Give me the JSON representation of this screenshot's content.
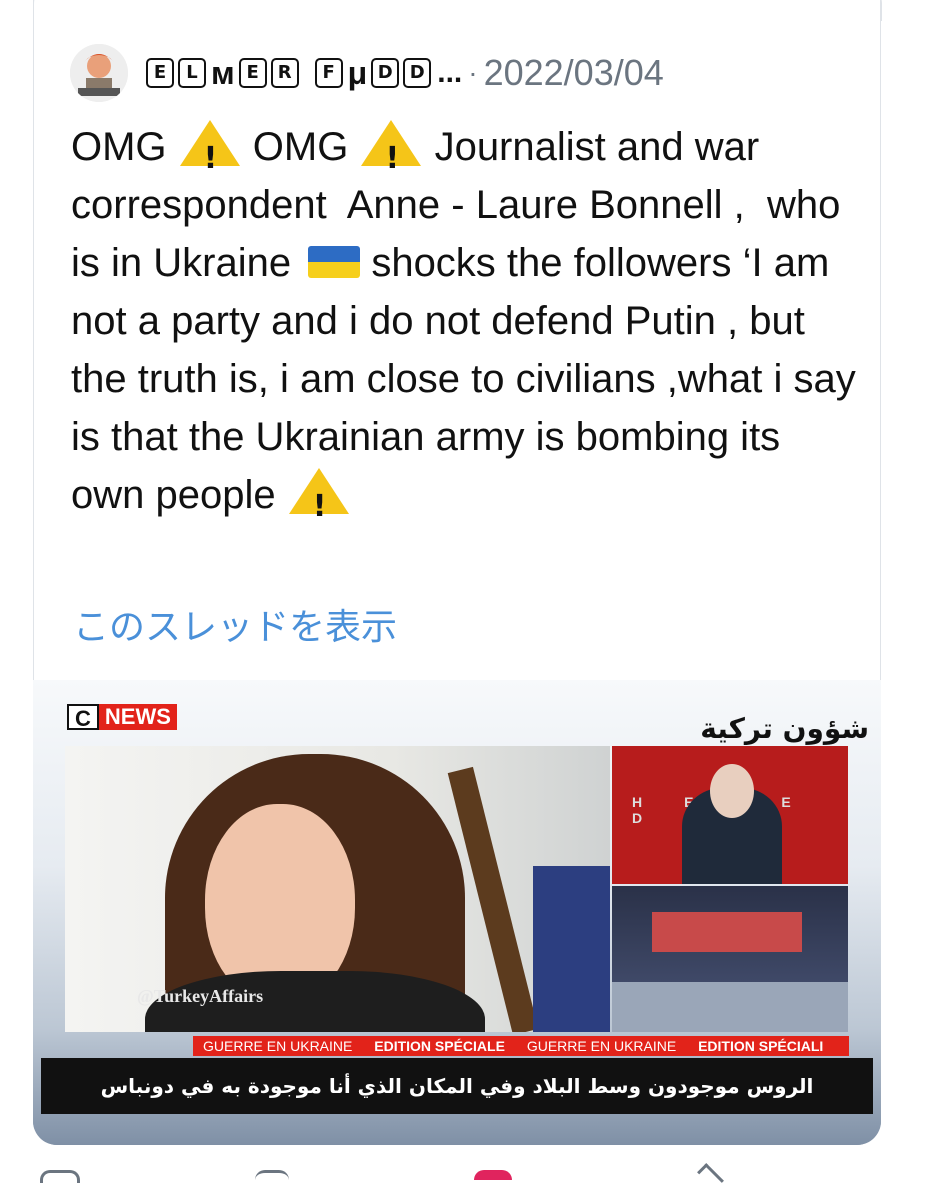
{
  "tweet": {
    "author_name_chars": [
      "E",
      "L",
      "M",
      "E",
      "R",
      "F",
      "D",
      "D"
    ],
    "author_mu": "μ",
    "author_ellipsis": "...",
    "separator": "·",
    "date": "2022/03/04",
    "text_part1": "OMG ",
    "text_part2": " OMG ",
    "text_part3": " Journalist and war correspondent  Anne - Laure Bonnell ,  who is in Ukraine ",
    "text_part4": " shocks the followers ‘I am not a party and i do not defend Putin , but the truth is, i am close to civilians ,what i say is that the Ukrainian army is bombing its own people ",
    "show_thread": "このスレッドを表示"
  },
  "media": {
    "channel_c": "C",
    "channel_news": "NEWS",
    "arabic_logo": "شؤون تركية",
    "watermark": "@TurkeyAffairs",
    "ticker": [
      "GUERRE EN UKRAINE",
      "EDITION SPÉCIALE",
      "GUERRE EN UKRAINE",
      "EDITION SPÉCIALI"
    ],
    "subtitle": "الروس موجودون وسط البلاد وفي المكان الذي أنا موجودة به في دونباس",
    "studio_letters": "HE E D"
  },
  "icons": {
    "warning": "warning-icon",
    "flag": "ukraine-flag-icon"
  }
}
